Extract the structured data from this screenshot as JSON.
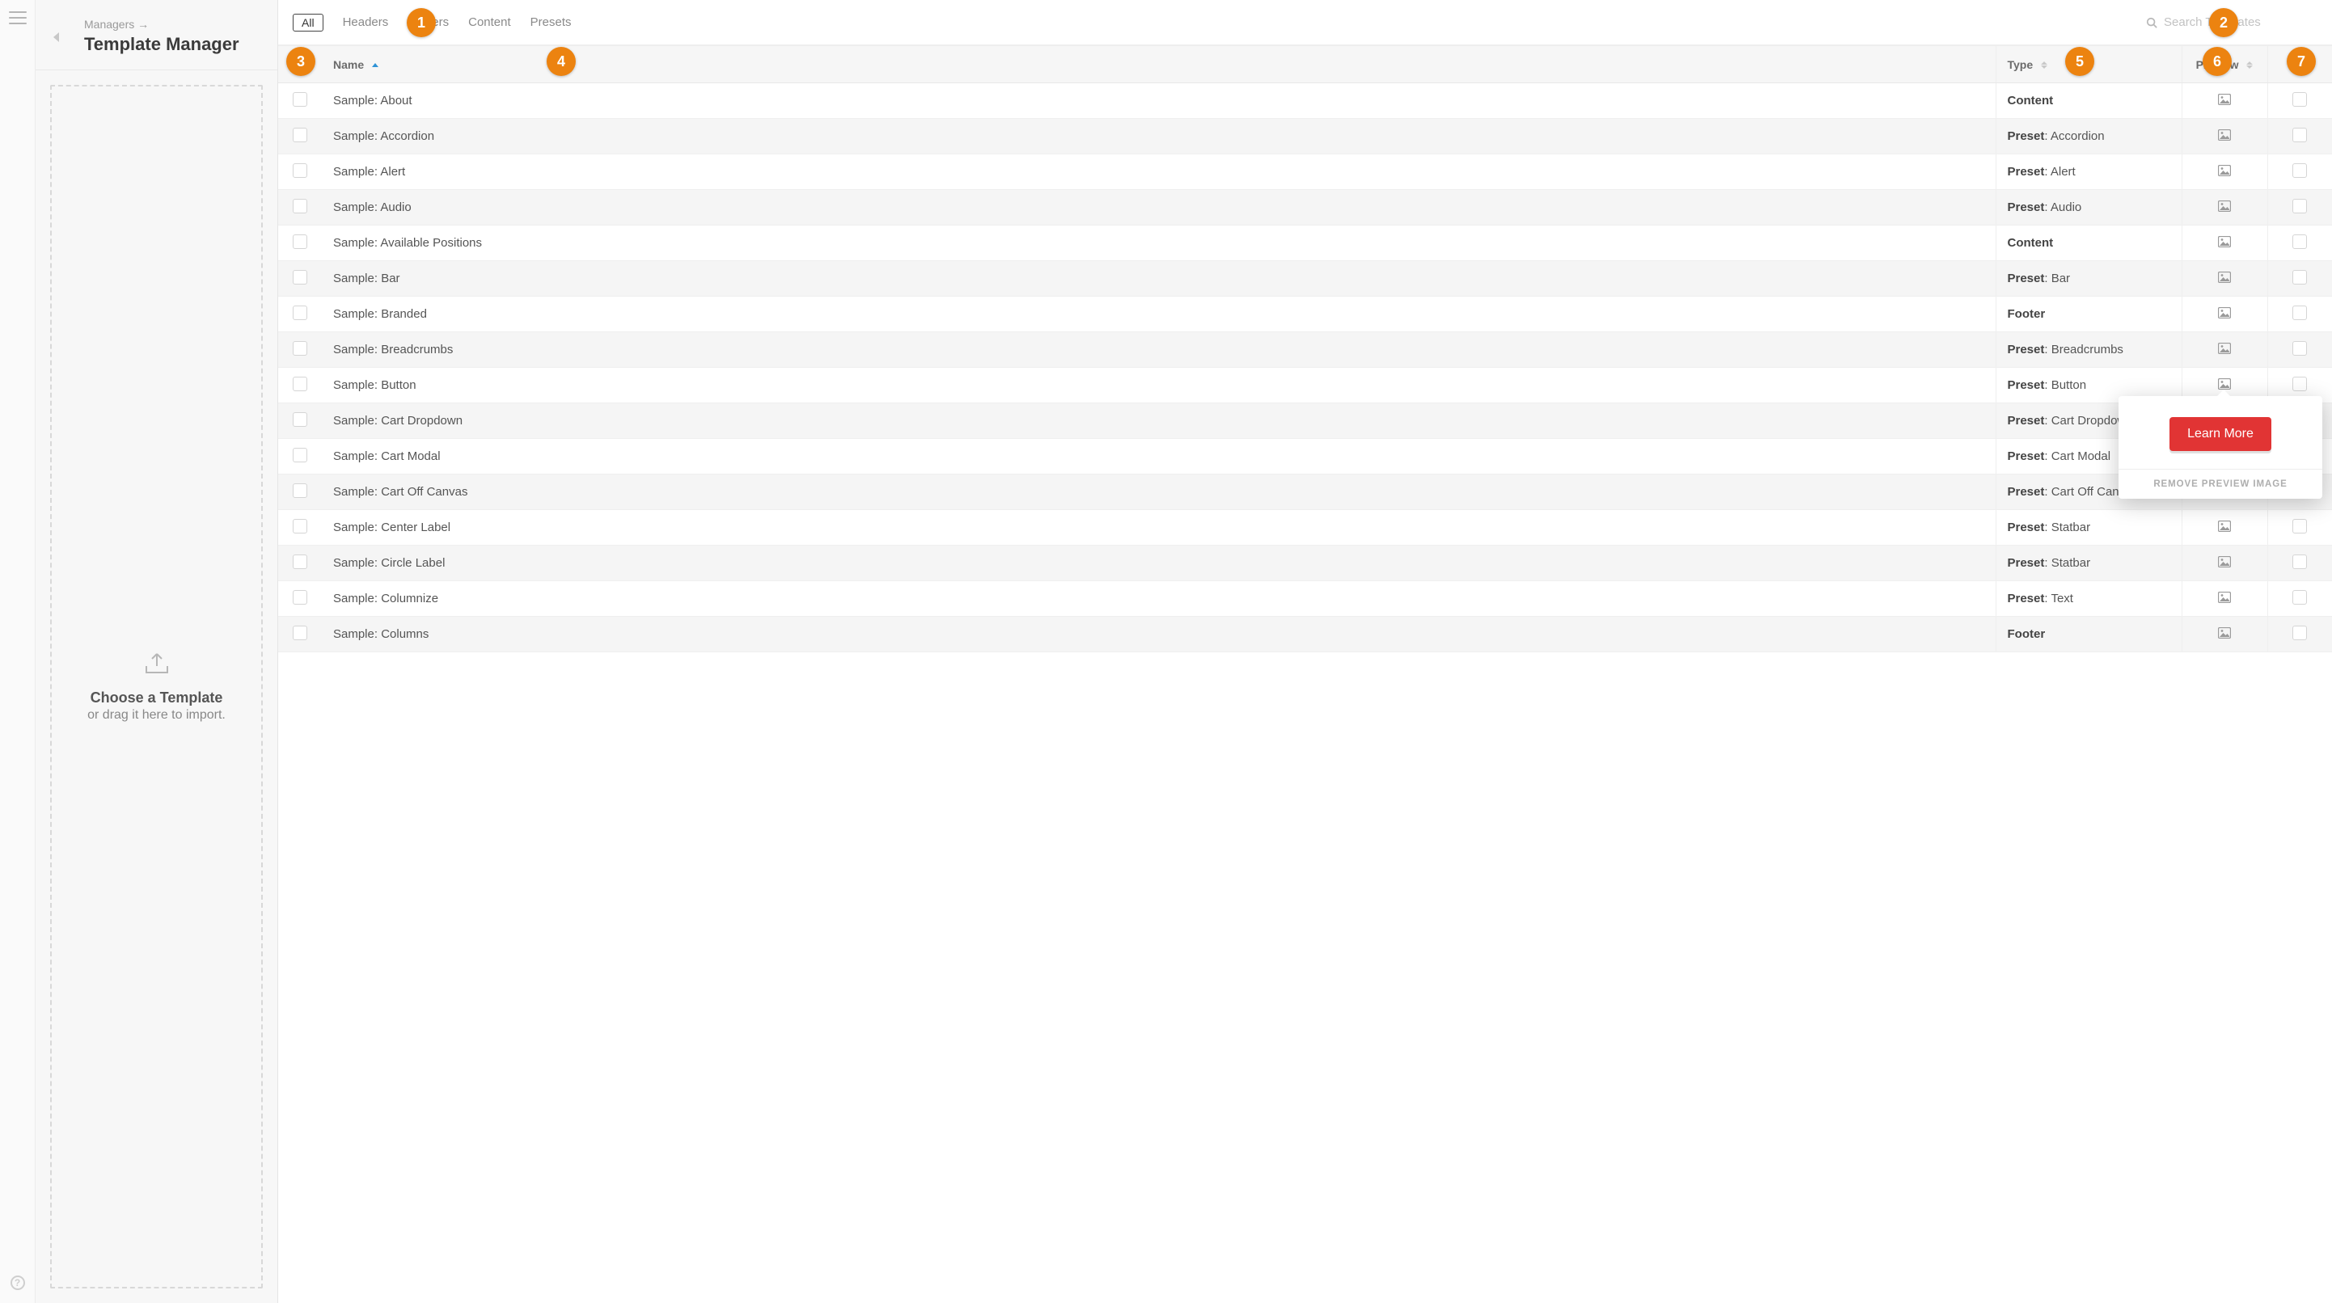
{
  "sidebar": {
    "breadcrumb": "Managers →",
    "title": "Template Manager",
    "dropzone_line1": "Choose a Template",
    "dropzone_line2": "or drag it here to import."
  },
  "toolbar": {
    "all": "All",
    "filters": [
      "Headers",
      "Footers",
      "Content",
      "Presets"
    ],
    "search_placeholder": "Search Templates"
  },
  "columns": {
    "name": "Name",
    "type": "Type",
    "preview": "Preview"
  },
  "rows": [
    {
      "name": "Sample: About",
      "type_bold": "Content",
      "type_rest": ""
    },
    {
      "name": "Sample: Accordion",
      "type_bold": "Preset",
      "type_rest": ": Accordion"
    },
    {
      "name": "Sample: Alert",
      "type_bold": "Preset",
      "type_rest": ": Alert"
    },
    {
      "name": "Sample: Audio",
      "type_bold": "Preset",
      "type_rest": ": Audio"
    },
    {
      "name": "Sample: Available Positions",
      "type_bold": "Content",
      "type_rest": ""
    },
    {
      "name": "Sample: Bar",
      "type_bold": "Preset",
      "type_rest": ": Bar"
    },
    {
      "name": "Sample: Branded",
      "type_bold": "Footer",
      "type_rest": ""
    },
    {
      "name": "Sample: Breadcrumbs",
      "type_bold": "Preset",
      "type_rest": ": Breadcrumbs"
    },
    {
      "name": "Sample: Button",
      "type_bold": "Preset",
      "type_rest": ": Button"
    },
    {
      "name": "Sample: Cart Dropdown",
      "type_bold": "Preset",
      "type_rest": ": Cart Dropdown"
    },
    {
      "name": "Sample: Cart Modal",
      "type_bold": "Preset",
      "type_rest": ": Cart Modal"
    },
    {
      "name": "Sample: Cart Off Canvas",
      "type_bold": "Preset",
      "type_rest": ": Cart Off Canvas"
    },
    {
      "name": "Sample: Center Label",
      "type_bold": "Preset",
      "type_rest": ": Statbar"
    },
    {
      "name": "Sample: Circle Label",
      "type_bold": "Preset",
      "type_rest": ": Statbar"
    },
    {
      "name": "Sample: Columnize",
      "type_bold": "Preset",
      "type_rest": ": Text"
    },
    {
      "name": "Sample: Columns",
      "type_bold": "Footer",
      "type_rest": ""
    }
  ],
  "popover": {
    "button": "Learn More",
    "remove": "REMOVE PREVIEW IMAGE"
  },
  "annotations": [
    "1",
    "2",
    "3",
    "4",
    "5",
    "6",
    "7"
  ]
}
